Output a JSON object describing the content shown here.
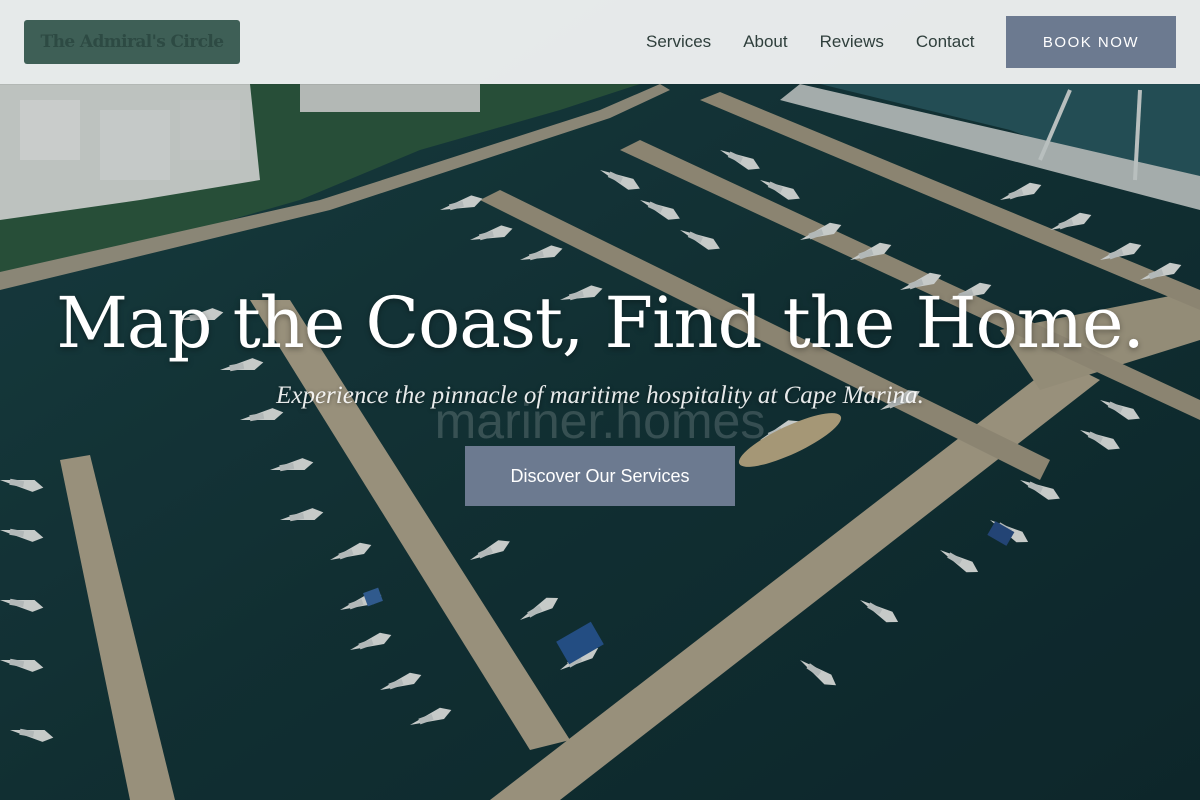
{
  "header": {
    "logo_text": "The Admiral's Circle",
    "nav": [
      {
        "label": "Services"
      },
      {
        "label": "About"
      },
      {
        "label": "Reviews"
      },
      {
        "label": "Contact"
      }
    ],
    "book_label": "BOOK NOW"
  },
  "hero": {
    "title": "Map the Coast, Find the Home.",
    "subtitle": "Experience the pinnacle of maritime hospitality at Cape Marina.",
    "watermark": "mariner.homes",
    "cta_label": "Discover Our Services",
    "background": "aerial-marina-photo"
  },
  "colors": {
    "accent_button": "#6c7a90",
    "logo_bg": "#3e5f56",
    "header_bg": "#f6f7f7",
    "water": "#123238",
    "dock": "#b9ab92"
  }
}
